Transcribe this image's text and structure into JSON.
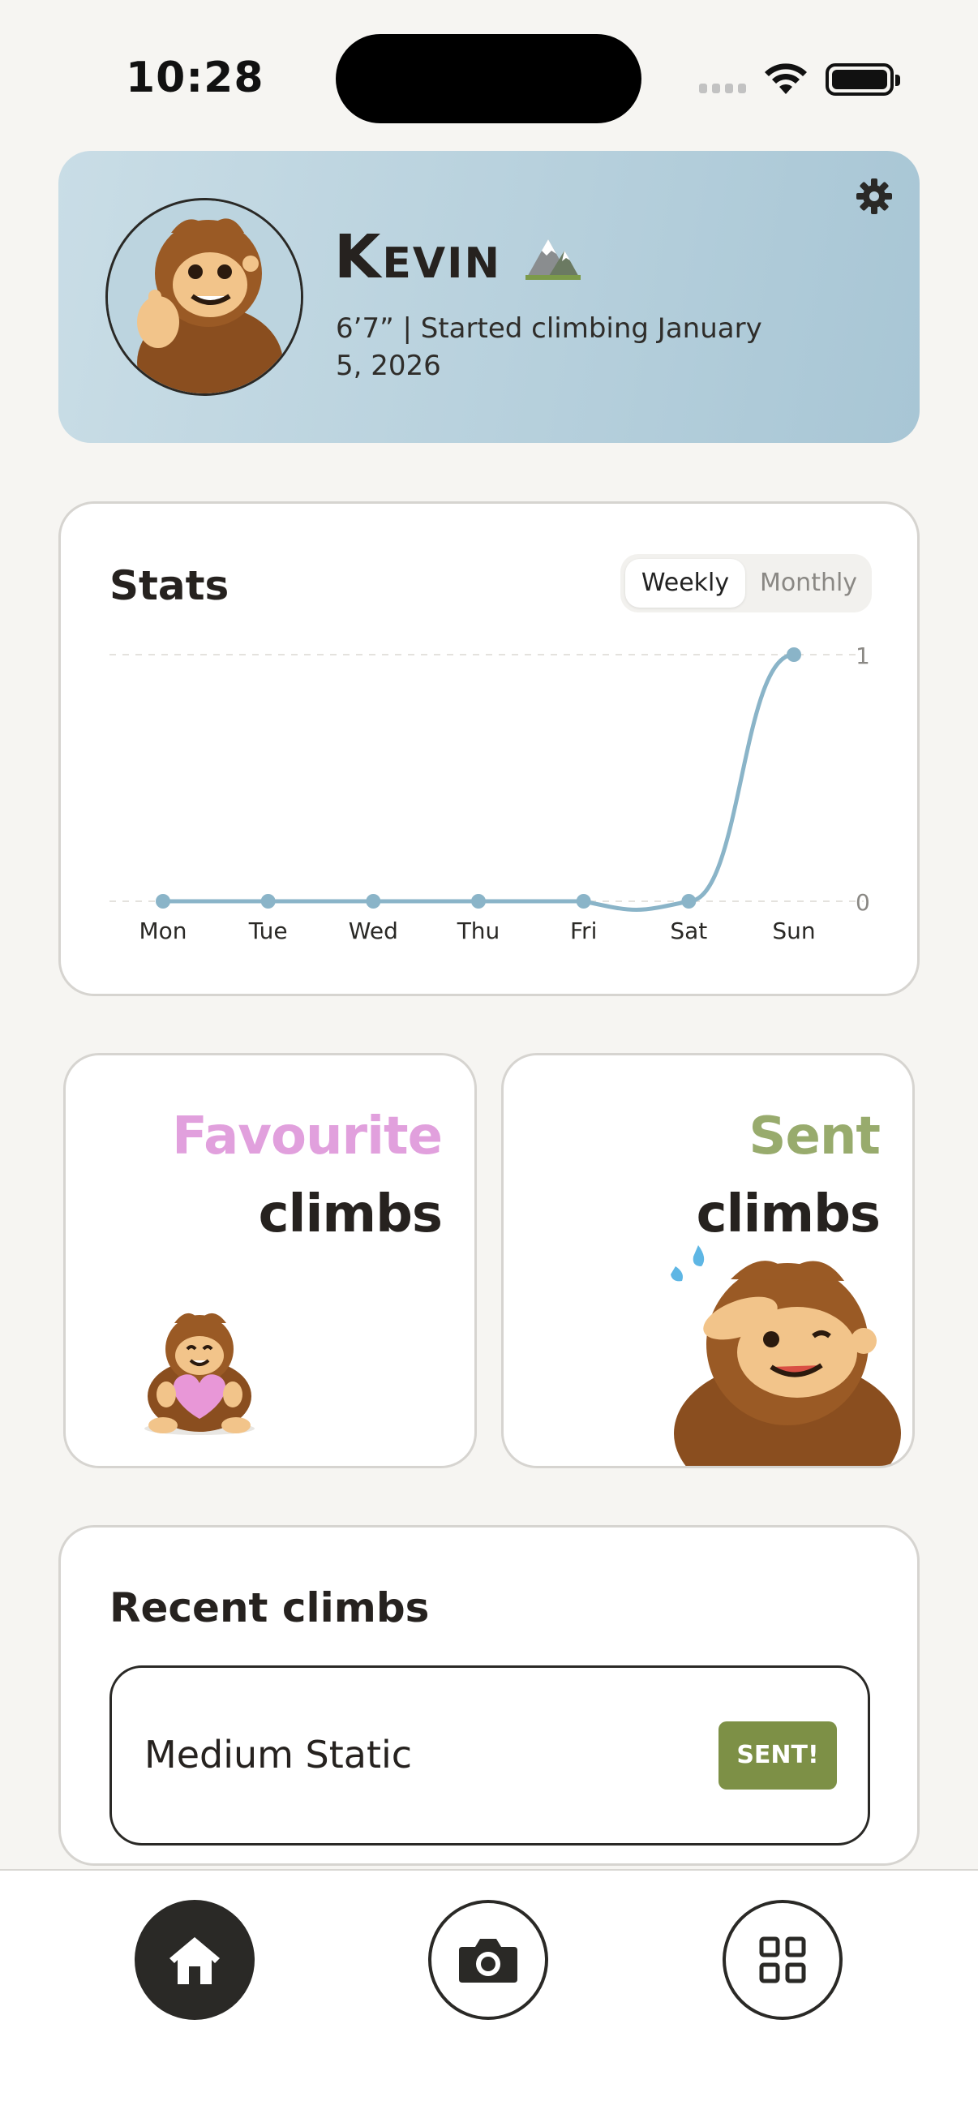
{
  "status_bar": {
    "time": "10:28",
    "wifi_icon": "wifi-icon",
    "battery_icon": "battery-icon"
  },
  "profile": {
    "name": "Kevin",
    "name_emoji": "mountain-icon",
    "subtitle": "6’7” | Started climbing January 5, 2026",
    "settings_icon": "gear-icon",
    "avatar": "bigfoot-thumbs-up-avatar"
  },
  "stats": {
    "title": "Stats",
    "toggle": {
      "weekly": "Weekly",
      "monthly": "Monthly",
      "selected": "Weekly"
    }
  },
  "chart_data": {
    "type": "line",
    "categories": [
      "Mon",
      "Tue",
      "Wed",
      "Thu",
      "Fri",
      "Sat",
      "Sun"
    ],
    "series": [
      {
        "values": [
          0,
          0,
          0,
          0,
          0,
          0,
          1
        ]
      }
    ],
    "y_ticks": [
      "0",
      "1"
    ],
    "ylim": [
      0,
      1
    ],
    "grid": "dashed horizontal",
    "line_color": "#8ab4c8",
    "title": "",
    "xlabel": "",
    "ylabel": ""
  },
  "categories": {
    "favourite": {
      "accent": "Favourite",
      "label": "climbs",
      "accent_color": "#e1a0dd"
    },
    "sent": {
      "accent": "Sent",
      "label": "climbs",
      "accent_color": "#98ab6d"
    }
  },
  "recent": {
    "title": "Recent climbs",
    "items": [
      {
        "name": "Medium Static",
        "badge": "SENT!"
      }
    ]
  },
  "tab_bar": {
    "items": [
      {
        "icon": "home-icon",
        "active": true
      },
      {
        "icon": "camera-icon",
        "active": false
      },
      {
        "icon": "grid-icon",
        "active": false
      }
    ]
  }
}
